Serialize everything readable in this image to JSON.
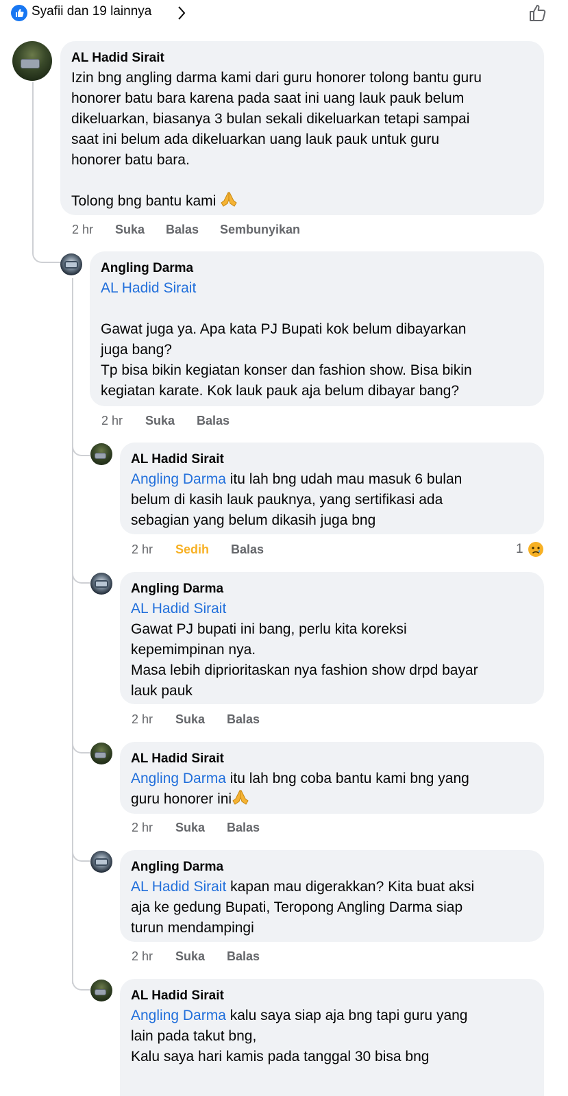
{
  "reactions_summary": {
    "icon": "like-icon",
    "text": "Syafii dan 19 lainnya",
    "chevron": "chevron-right-icon",
    "like_button": "thumb-up-outline-icon"
  },
  "comments": [
    {
      "author": "AL Hadid Sirait",
      "avatar": "al-hadid-avatar",
      "mention": "",
      "lines": "Izin bng angling darma kami dari guru honorer tolong bantu guru\nhonorer batu bara karena pada saat ini uang lauk pauk belum\ndikeluarkan, biasanya 3 bulan sekali dikeluarkan tetapi sampai\nsaat ini belum ada dikeluarkan uang lauk pauk untuk guru\nhonorer batu bara.\n\n Tolong bng bantu kami ",
      "time": "2 hr",
      "like": "Suka",
      "reply": "Balas",
      "hide": "Sembunyikan"
    },
    {
      "author": "Angling Darma",
      "avatar": "angling-darma-avatar",
      "mention": "AL Hadid Sirait",
      "lines": "Gawat juga ya. Apa kata PJ Bupati kok belum dibayarkan\njuga bang?\nTp bisa bikin kegiatan konser dan fashion show. Bisa bikin\nkegiatan karate. Kok lauk pauk aja belum dibayar bang?",
      "time": "2 hr",
      "like": "Suka",
      "reply": "Balas"
    },
    {
      "author": "AL Hadid Sirait",
      "avatar": "al-hadid-avatar",
      "mention": "Angling Darma",
      "lines_first": " itu lah bng udah mau masuk 6 bulan",
      "lines": "belum di kasih lauk pauknya, yang sertifikasi ada\nsebagian yang belum dikasih juga bng",
      "time": "2 hr",
      "like": "Sedih",
      "reply": "Balas",
      "reaction_count": "1",
      "reaction_icon": "sad-face-icon"
    },
    {
      "author": "Angling Darma",
      "avatar": "angling-darma-avatar",
      "mention": "AL Hadid Sirait",
      "lines": "Gawat PJ bupati ini bang, perlu kita koreksi\nkepemimpinan nya.\nMasa lebih diprioritaskan nya fashion show drpd bayar\nlauk pauk",
      "time": "2 hr",
      "like": "Suka",
      "reply": "Balas"
    },
    {
      "author": "AL Hadid Sirait",
      "avatar": "al-hadid-avatar",
      "mention": "Angling Darma",
      "lines_first": " itu lah bng coba bantu kami bng yang",
      "lines": "guru honorer ini",
      "time": "2 hr",
      "like": "Suka",
      "reply": "Balas"
    },
    {
      "author": "Angling Darma",
      "avatar": "angling-darma-avatar",
      "mention": "AL Hadid Sirait",
      "lines_first": " kapan mau digerakkan? Kita buat aksi",
      "lines": "aja ke gedung Bupati, Teropong Angling Darma siap\nturun mendampingi",
      "time": "2 hr",
      "like": "Suka",
      "reply": "Balas"
    },
    {
      "author": "AL Hadid Sirait",
      "avatar": "al-hadid-avatar",
      "mention": "Angling Darma",
      "lines_first": " kalu saya siap aja bng tapi guru yang",
      "lines": "lain pada takut bng,\n Kalu saya hari kamis pada tanggal 30 bisa bng"
    }
  ],
  "colors": {
    "bubble": "#f0f2f5",
    "mention": "#216fdb",
    "sedih": "#f7b125",
    "like_badge": "#1877f2"
  }
}
